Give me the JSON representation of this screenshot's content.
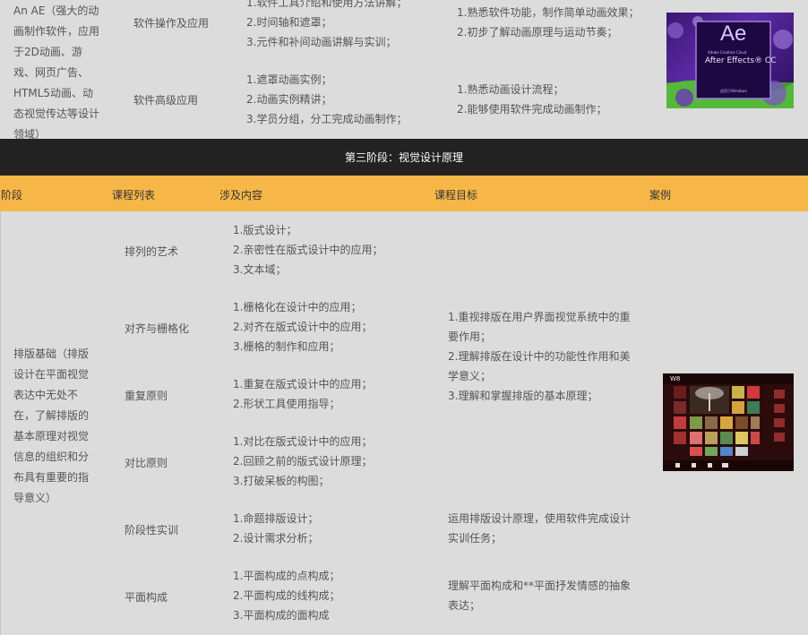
{
  "prev_section": {
    "description": "An AE（强大的动画制作软件，应用于2D动画、游戏、网页广告、HTML5动画、动态视觉传达等设计领域）",
    "rows": [
      {
        "course": "软件操作及应用",
        "content": [
          "1.软件工具介绍和使用方法讲解；",
          "2.时间轴和遮罩；",
          "3.元件和补间动画讲解与实训；"
        ],
        "goals": [
          "1.熟悉软件功能，制作简单动画效果；",
          "2.初步了解动画原理与运动节奏；"
        ]
      },
      {
        "course": "软件高级应用",
        "content": [
          "1.遮罩动画实例；",
          "2.动画实例精讲；",
          "3.学员分组，分工完成动画制作；"
        ],
        "goals": [
          "1.熟悉动画设计流程；",
          "2.能够使用软件完成动画制作；"
        ]
      }
    ],
    "ae_image": {
      "logo": "Ae",
      "small_text": "Adobe Creative Cloud",
      "product": "After Effects® CC",
      "footer": "适用于Windows"
    }
  },
  "stage3": {
    "title": "第三阶段：视觉设计原理",
    "headers": {
      "stage": "阶段",
      "course": "课程列表",
      "content": "涉及内容",
      "goal": "课程目标",
      "case": "案例"
    },
    "description": "排版基础（排版设计在平面视觉表达中无处不在，了解排版的基本原理对视觉信息的组织和分布具有重要的指导意义）",
    "rows": [
      {
        "course": "排列的艺术",
        "content": [
          "1.版式设计；",
          "2.亲密性在版式设计中的应用；",
          "3.文本域；"
        ]
      },
      {
        "course": "对齐与栅格化",
        "content": [
          "1.栅格化在设计中的应用；",
          "2.对齐在版式设计中的应用；",
          "3.栅格的制作和应用；"
        ]
      },
      {
        "course": "重复原则",
        "content": [
          "1.重复在版式设计中的应用；",
          "2.形状工具使用指导；"
        ]
      },
      {
        "course": "对比原则",
        "content": [
          "1.对比在版式设计中的应用；",
          "2.回顾之前的版式设计原理；",
          "3.打破呆板的构图；"
        ]
      },
      {
        "course": "阶段性实训",
        "content": [
          "1.命题排版设计；",
          "2.设计需求分析；"
        ]
      },
      {
        "course": "平面构成",
        "content": [
          "1.平面构成的点构成；",
          "2.平面构成的线构成；",
          "3.平面构成的面构成"
        ]
      }
    ],
    "group_goal": [
      "1.重视排版在用户界面视觉系统中的重要作用；",
      "2.理解排版在设计中的功能性作用和美学意义；",
      "3.理解和掌握排版的基本原理；"
    ],
    "training_goal": "运用排版设计原理，使用软件完成设计实训任务；",
    "composition_goal": "理解平面构成和**平面抒发情感的抽象表达；",
    "win8_image": {
      "brand": "W8"
    }
  },
  "colors": {
    "dark_band": "#222222",
    "header_bar": "#f7b748",
    "table_bg": "#dcdcdc"
  }
}
